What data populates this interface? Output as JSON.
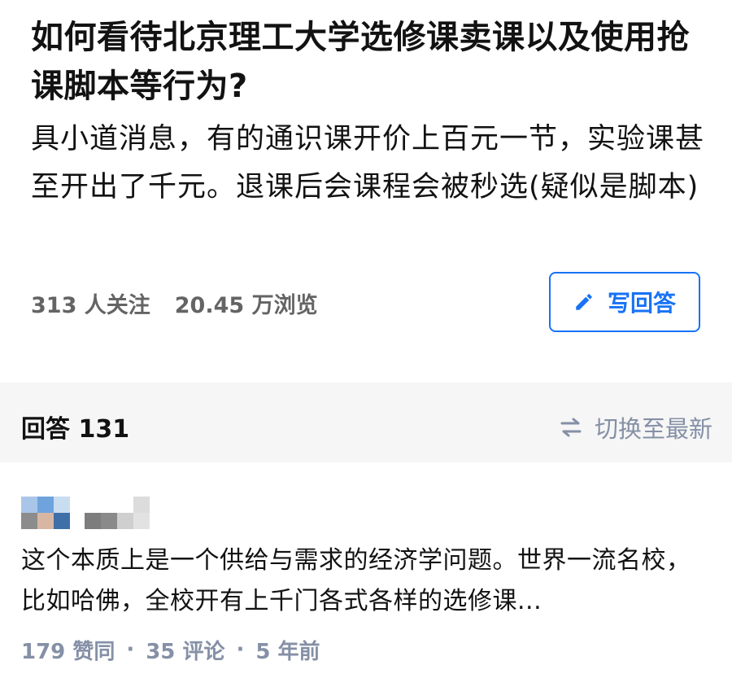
{
  "question": {
    "title": "如何看待北京理工大学选修课卖课以及使用抢课脚本等行为?",
    "detail": "具小道消息，有的通识课开价上百元一节，实验课甚至开出了千元。退课后会课程会被秒选(疑似是脚本)",
    "stats": {
      "followers": "313 人关注",
      "views": "20.45 万浏览"
    },
    "write_answer_label": "写回答",
    "write_icon": "pencil-icon"
  },
  "answers_header": {
    "count_label": "回答 131",
    "sort_label": "切换至最新",
    "sort_icon": "swap-arrows-icon"
  },
  "answer": {
    "excerpt": "这个本质上是一个供给与需求的经济学问题。世界一流名校，比如哈佛，全校开有上千门各式各样的选修课...",
    "meta": {
      "upvotes": "179 赞同",
      "comments": "35 评论",
      "time": "5 年前",
      "separator": "·"
    },
    "avatar_colors": [
      "#a9c6e8",
      "#6ea3dd",
      "#c9ddf1",
      "#8c8c8c",
      "#d7b7a4",
      "#3f6fa8"
    ],
    "author_colors": [
      "#ffffff",
      "#ffffff",
      "#ffffff",
      "#dcdcdc",
      "#7d7d7d",
      "#8a8a8a",
      "#cfcfcf",
      "#e2e2e2"
    ]
  },
  "colors": {
    "accent": "#1772f6",
    "muted": "#8590a6",
    "text": "#121212",
    "band": "#f6f6f6"
  }
}
